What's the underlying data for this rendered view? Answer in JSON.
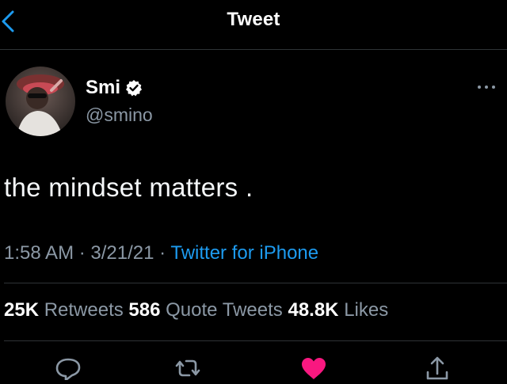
{
  "header": {
    "title": "Tweet",
    "back_icon": "chevron-left-icon"
  },
  "author": {
    "display_name": "Smi",
    "handle": "@smino",
    "verified_icon": "verified-badge-icon"
  },
  "tweet": {
    "text": "the mindset matters .",
    "time": "1:58 AM",
    "separator_1": " · ",
    "date": "3/21/21",
    "separator_2": " · ",
    "source": "Twitter for iPhone"
  },
  "stats": {
    "retweets_count": "25K",
    "retweets_label": "Retweets",
    "quotes_count": "586",
    "quotes_label": "Quote Tweets",
    "likes_count": "48.8K",
    "likes_label": "Likes"
  },
  "actions": {
    "reply_icon": "reply-icon",
    "retweet_icon": "retweet-icon",
    "like_icon": "heart-filled-icon",
    "share_icon": "share-icon"
  },
  "colors": {
    "background": "#000000",
    "accent": "#1d9bf0",
    "like": "#f91880",
    "secondary_text": "#8b98a5",
    "divider": "#2f3336"
  }
}
